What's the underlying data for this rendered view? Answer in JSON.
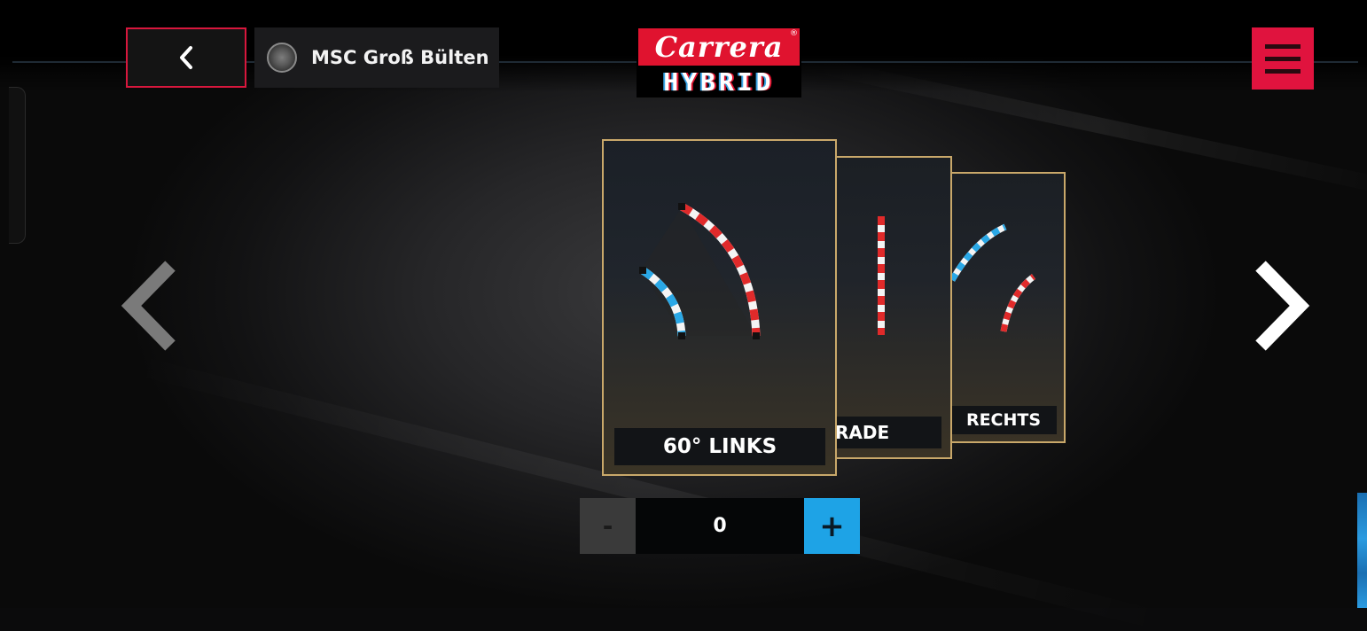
{
  "header": {
    "location_name": "MSC Groß Bülten",
    "logo_top_text": "Carrera",
    "logo_bottom_text": "HYBRID",
    "logo_registered": "®"
  },
  "icons": {
    "back": "chevron-left-icon",
    "menu": "hamburger-menu-icon",
    "prev": "chevron-left-large-icon",
    "next": "chevron-right-large-icon"
  },
  "carousel": {
    "cards": [
      {
        "label": "60° LINKS"
      },
      {
        "label": "RADE"
      },
      {
        "label": "RECHTS"
      }
    ]
  },
  "stepper": {
    "minus_label": "-",
    "count": "0",
    "plus_label": "+"
  },
  "colors": {
    "accent_red": "#e0133e",
    "accent_blue": "#1ea3e6",
    "card_border": "#c9a86a"
  }
}
